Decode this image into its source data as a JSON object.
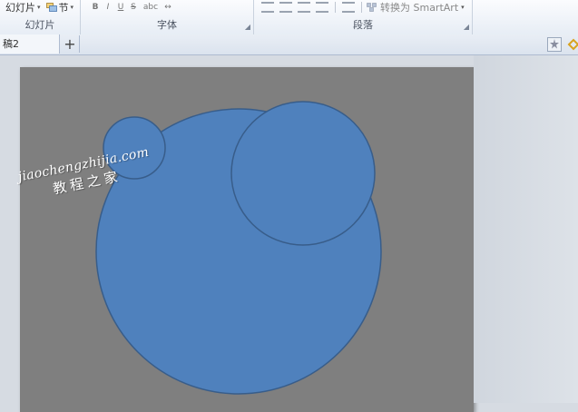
{
  "ribbon": {
    "groups": [
      {
        "label": "幻灯片",
        "buttons": [
          {
            "label": "幻灯片",
            "dropdown": "▾"
          },
          {
            "label": "节",
            "dropdown": "▾"
          }
        ]
      },
      {
        "label": "字体",
        "buttons": [
          "B",
          "I",
          "U",
          "S",
          "abc",
          "↔"
        ]
      },
      {
        "label": "段落",
        "smartart_label": "转换为 SmartArt",
        "smartart_dropdown": "▾"
      }
    ]
  },
  "tabs": [
    {
      "label": "稿2"
    }
  ],
  "add_tab_label": "+",
  "watermark": {
    "url": "jiaochengzhijia.com",
    "cn": "教程之家"
  },
  "colors": {
    "slide_bg": "#7f7f7f",
    "circle_fill": "#4f81bd",
    "circle_stroke": "#385d8a"
  },
  "icons": [
    "slides-icon",
    "section-icon",
    "bold-icon",
    "italic-icon",
    "underline-icon",
    "strikethrough-icon",
    "smartart-icon",
    "magic-icon",
    "shape-icon"
  ]
}
